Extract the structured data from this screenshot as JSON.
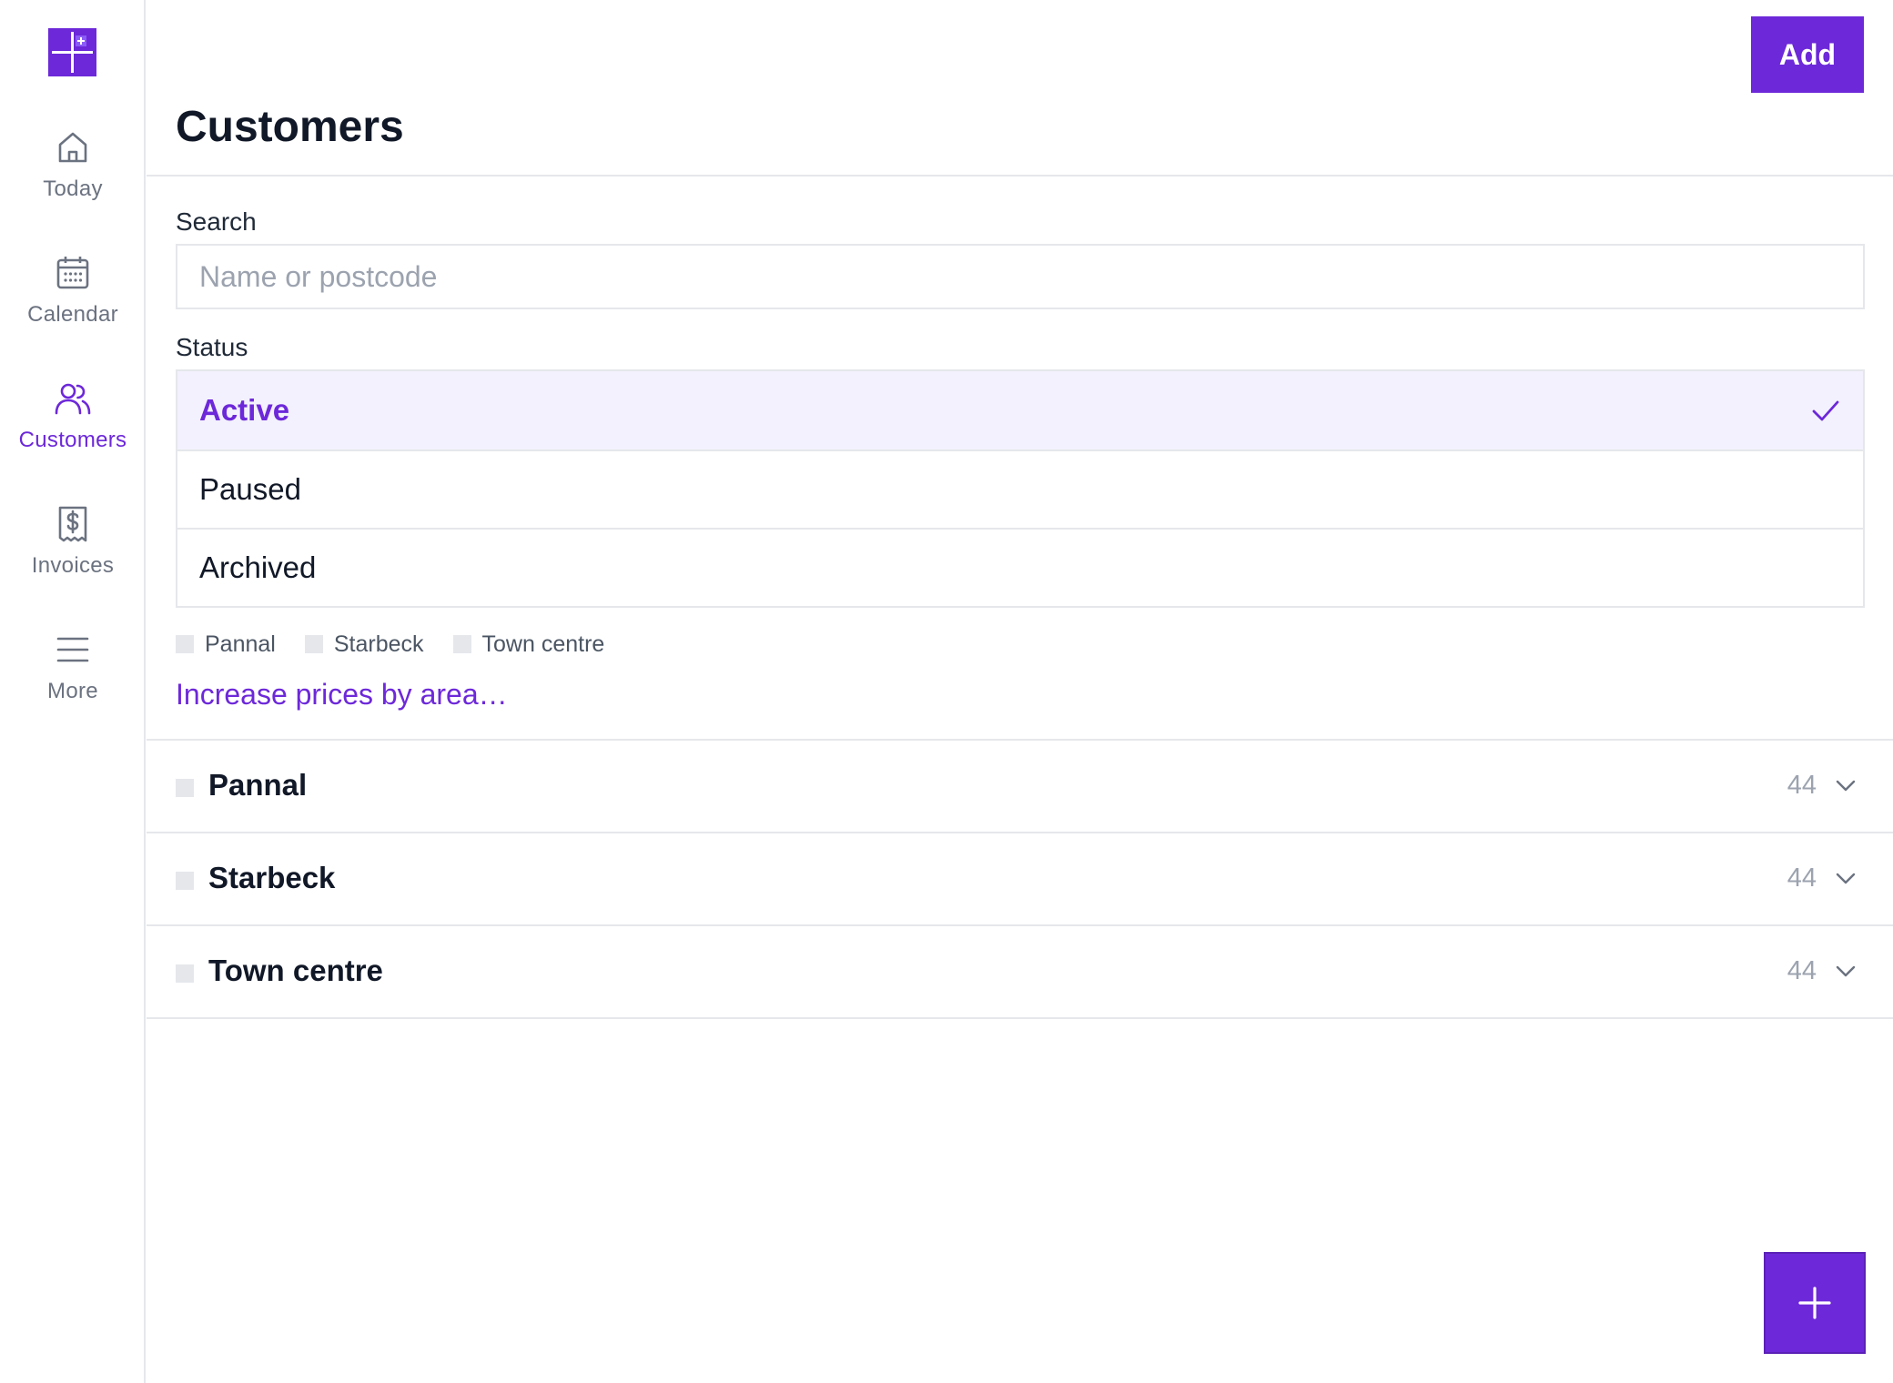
{
  "sidebar": {
    "items": [
      {
        "label": "Today",
        "icon": "home-icon"
      },
      {
        "label": "Calendar",
        "icon": "calendar-icon"
      },
      {
        "label": "Customers",
        "icon": "users-icon"
      },
      {
        "label": "Invoices",
        "icon": "receipt-dollar-icon"
      },
      {
        "label": "More",
        "icon": "menu-icon"
      }
    ],
    "active": "Customers"
  },
  "header": {
    "title": "Customers",
    "add_label": "Add"
  },
  "search": {
    "label": "Search",
    "placeholder": "Name or postcode",
    "value": ""
  },
  "status": {
    "label": "Status",
    "options": [
      "Active",
      "Paused",
      "Archived"
    ],
    "selected": "Active"
  },
  "area_filters": [
    "Pannal",
    "Starbeck",
    "Town centre"
  ],
  "increase_prices_link": "Increase prices by area…",
  "groups": [
    {
      "name": "Pannal",
      "count": "44"
    },
    {
      "name": "Starbeck",
      "count": "44"
    },
    {
      "name": "Town centre",
      "count": "44"
    }
  ],
  "colors": {
    "accent": "#6d28d9",
    "selected_bg": "#f3f1fd",
    "border": "#e5e7eb",
    "muted": "#9ca3af"
  }
}
